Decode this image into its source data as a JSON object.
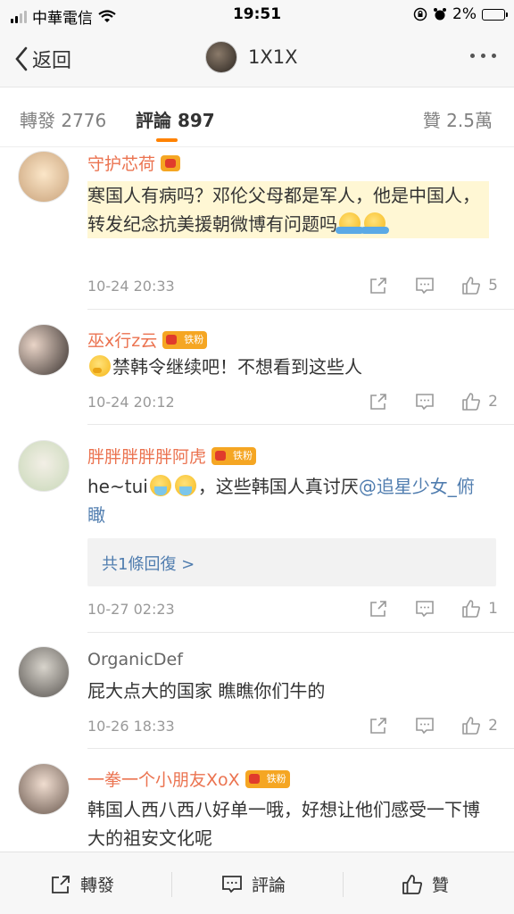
{
  "status_bar": {
    "carrier": "中華電信",
    "time": "19:51",
    "battery": "2%"
  },
  "nav": {
    "back_label": "返回",
    "title": "1X1X"
  },
  "tabs": [
    {
      "label": "轉發 2776"
    },
    {
      "label": "評論 897"
    },
    {
      "label": "贊 2.5萬"
    }
  ],
  "comments": [
    {
      "name": "守护芯荷",
      "text": "寒国人有病吗？邓伦父母都是军人，他是中国人，转发纪念抗美援朝微博有问题吗",
      "time": "10-24 20:33",
      "likes": "5"
    },
    {
      "name": "巫x行z云",
      "badge": "铁粉",
      "text": "禁韩令继续吧！不想看到这些人",
      "time": "10-24 20:12",
      "likes": "2"
    },
    {
      "name": "胖胖胖胖胖阿虎",
      "badge": "铁粉",
      "text_a": "he~tui",
      "text_b": "，这些韩国人真讨厌",
      "mention": "@追星少女_俯瞰",
      "reply_label": "共1條回復 >",
      "time": "10-27 02:23",
      "likes": "1"
    },
    {
      "name": "OrganicDef",
      "text": "屁大点大的国家 瞧瞧你们牛的",
      "time": "10-26 18:33",
      "likes": "2"
    },
    {
      "name": "一拳一个小朋友XoX",
      "badge": "铁粉",
      "text": "韩国人西八西八好单一哦，好想让他们感受一下博大的祖安文化呢"
    }
  ],
  "bottom_bar": {
    "repost": "轉發",
    "comment": "評論",
    "like": "贊"
  },
  "colors": {
    "accent": "#ff8200",
    "name_orange": "#eb7350",
    "link": "#507daf"
  }
}
